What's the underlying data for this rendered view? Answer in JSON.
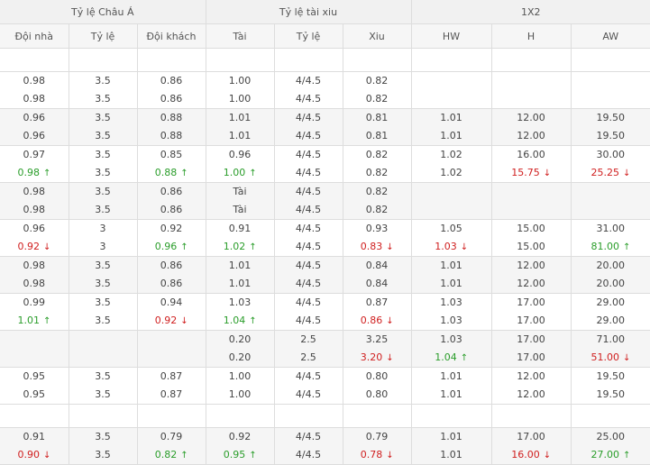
{
  "groups": [
    "Tỷ lệ Châu Á",
    "Tỷ lệ tài xiu",
    "1X2"
  ],
  "columns": [
    "Đội nhà",
    "Tỷ lệ",
    "Đội khách",
    "Tài",
    "Tỷ lệ",
    "Xiu",
    "HW",
    "H",
    "AW"
  ],
  "rows": [
    null,
    [
      [
        [
          "0.98",
          ""
        ],
        [
          "0.98",
          ""
        ]
      ],
      [
        [
          "3.5",
          ""
        ],
        [
          "3.5",
          ""
        ]
      ],
      [
        [
          "0.86",
          ""
        ],
        [
          "0.86",
          ""
        ]
      ],
      [
        [
          "1.00",
          ""
        ],
        [
          "1.00",
          ""
        ]
      ],
      [
        [
          "4/4.5",
          ""
        ],
        [
          "4/4.5",
          ""
        ]
      ],
      [
        [
          "0.82",
          ""
        ],
        [
          "0.82",
          ""
        ]
      ],
      [
        [
          "",
          ""
        ],
        [
          "",
          ""
        ]
      ],
      [
        [
          "",
          ""
        ],
        [
          "",
          ""
        ]
      ],
      [
        [
          "",
          ""
        ],
        [
          "",
          ""
        ]
      ]
    ],
    [
      [
        [
          "0.96",
          ""
        ],
        [
          "0.96",
          ""
        ]
      ],
      [
        [
          "3.5",
          ""
        ],
        [
          "3.5",
          ""
        ]
      ],
      [
        [
          "0.88",
          ""
        ],
        [
          "0.88",
          ""
        ]
      ],
      [
        [
          "1.01",
          ""
        ],
        [
          "1.01",
          ""
        ]
      ],
      [
        [
          "4/4.5",
          ""
        ],
        [
          "4/4.5",
          ""
        ]
      ],
      [
        [
          "0.81",
          ""
        ],
        [
          "0.81",
          ""
        ]
      ],
      [
        [
          "1.01",
          ""
        ],
        [
          "1.01",
          ""
        ]
      ],
      [
        [
          "12.00",
          ""
        ],
        [
          "12.00",
          ""
        ]
      ],
      [
        [
          "19.50",
          ""
        ],
        [
          "19.50",
          ""
        ]
      ]
    ],
    [
      [
        [
          "0.97",
          ""
        ],
        [
          "0.98",
          "up"
        ]
      ],
      [
        [
          "3.5",
          ""
        ],
        [
          "3.5",
          ""
        ]
      ],
      [
        [
          "0.85",
          ""
        ],
        [
          "0.88",
          "up"
        ]
      ],
      [
        [
          "0.96",
          ""
        ],
        [
          "1.00",
          "up"
        ]
      ],
      [
        [
          "4/4.5",
          ""
        ],
        [
          "4/4.5",
          ""
        ]
      ],
      [
        [
          "0.82",
          ""
        ],
        [
          "0.82",
          ""
        ]
      ],
      [
        [
          "1.02",
          ""
        ],
        [
          "1.02",
          ""
        ]
      ],
      [
        [
          "16.00",
          ""
        ],
        [
          "15.75",
          "down"
        ]
      ],
      [
        [
          "30.00",
          ""
        ],
        [
          "25.25",
          "down"
        ]
      ]
    ],
    [
      [
        [
          "0.98",
          ""
        ],
        [
          "0.98",
          ""
        ]
      ],
      [
        [
          "3.5",
          ""
        ],
        [
          "3.5",
          ""
        ]
      ],
      [
        [
          "0.86",
          ""
        ],
        [
          "0.86",
          ""
        ]
      ],
      [
        [
          "Tài",
          ""
        ],
        [
          "Tài",
          ""
        ]
      ],
      [
        [
          "4/4.5",
          ""
        ],
        [
          "4/4.5",
          ""
        ]
      ],
      [
        [
          "0.82",
          ""
        ],
        [
          "0.82",
          ""
        ]
      ],
      [
        [
          "",
          ""
        ],
        [
          "",
          ""
        ]
      ],
      [
        [
          "",
          ""
        ],
        [
          "",
          ""
        ]
      ],
      [
        [
          "",
          ""
        ],
        [
          "",
          ""
        ]
      ]
    ],
    [
      [
        [
          "0.96",
          ""
        ],
        [
          "0.92",
          "down"
        ]
      ],
      [
        [
          "3",
          ""
        ],
        [
          "3",
          ""
        ]
      ],
      [
        [
          "0.92",
          ""
        ],
        [
          "0.96",
          "up"
        ]
      ],
      [
        [
          "0.91",
          ""
        ],
        [
          "1.02",
          "up"
        ]
      ],
      [
        [
          "4/4.5",
          ""
        ],
        [
          "4/4.5",
          ""
        ]
      ],
      [
        [
          "0.93",
          ""
        ],
        [
          "0.83",
          "down"
        ]
      ],
      [
        [
          "1.05",
          ""
        ],
        [
          "1.03",
          "down"
        ]
      ],
      [
        [
          "15.00",
          ""
        ],
        [
          "15.00",
          ""
        ]
      ],
      [
        [
          "31.00",
          ""
        ],
        [
          "81.00",
          "up"
        ]
      ]
    ],
    [
      [
        [
          "0.98",
          ""
        ],
        [
          "0.98",
          ""
        ]
      ],
      [
        [
          "3.5",
          ""
        ],
        [
          "3.5",
          ""
        ]
      ],
      [
        [
          "0.86",
          ""
        ],
        [
          "0.86",
          ""
        ]
      ],
      [
        [
          "1.01",
          ""
        ],
        [
          "1.01",
          ""
        ]
      ],
      [
        [
          "4/4.5",
          ""
        ],
        [
          "4/4.5",
          ""
        ]
      ],
      [
        [
          "0.84",
          ""
        ],
        [
          "0.84",
          ""
        ]
      ],
      [
        [
          "1.01",
          ""
        ],
        [
          "1.01",
          ""
        ]
      ],
      [
        [
          "12.00",
          ""
        ],
        [
          "12.00",
          ""
        ]
      ],
      [
        [
          "20.00",
          ""
        ],
        [
          "20.00",
          ""
        ]
      ]
    ],
    [
      [
        [
          "0.99",
          ""
        ],
        [
          "1.01",
          "up"
        ]
      ],
      [
        [
          "3.5",
          ""
        ],
        [
          "3.5",
          ""
        ]
      ],
      [
        [
          "0.94",
          ""
        ],
        [
          "0.92",
          "down"
        ]
      ],
      [
        [
          "1.03",
          ""
        ],
        [
          "1.04",
          "up"
        ]
      ],
      [
        [
          "4/4.5",
          ""
        ],
        [
          "4/4.5",
          ""
        ]
      ],
      [
        [
          "0.87",
          ""
        ],
        [
          "0.86",
          "down"
        ]
      ],
      [
        [
          "1.03",
          ""
        ],
        [
          "1.03",
          ""
        ]
      ],
      [
        [
          "17.00",
          ""
        ],
        [
          "17.00",
          ""
        ]
      ],
      [
        [
          "29.00",
          ""
        ],
        [
          "29.00",
          ""
        ]
      ]
    ],
    [
      [
        [
          "",
          ""
        ],
        [
          "",
          ""
        ]
      ],
      [
        [
          "",
          ""
        ],
        [
          "",
          ""
        ]
      ],
      [
        [
          "",
          ""
        ],
        [
          "",
          ""
        ]
      ],
      [
        [
          "0.20",
          ""
        ],
        [
          "0.20",
          ""
        ]
      ],
      [
        [
          "2.5",
          ""
        ],
        [
          "2.5",
          ""
        ]
      ],
      [
        [
          "3.25",
          ""
        ],
        [
          "3.20",
          "down"
        ]
      ],
      [
        [
          "1.03",
          ""
        ],
        [
          "1.04",
          "up"
        ]
      ],
      [
        [
          "17.00",
          ""
        ],
        [
          "17.00",
          ""
        ]
      ],
      [
        [
          "71.00",
          ""
        ],
        [
          "51.00",
          "down"
        ]
      ]
    ],
    [
      [
        [
          "0.95",
          ""
        ],
        [
          "0.95",
          ""
        ]
      ],
      [
        [
          "3.5",
          ""
        ],
        [
          "3.5",
          ""
        ]
      ],
      [
        [
          "0.87",
          ""
        ],
        [
          "0.87",
          ""
        ]
      ],
      [
        [
          "1.00",
          ""
        ],
        [
          "1.00",
          ""
        ]
      ],
      [
        [
          "4/4.5",
          ""
        ],
        [
          "4/4.5",
          ""
        ]
      ],
      [
        [
          "0.80",
          ""
        ],
        [
          "0.80",
          ""
        ]
      ],
      [
        [
          "1.01",
          ""
        ],
        [
          "1.01",
          ""
        ]
      ],
      [
        [
          "12.00",
          ""
        ],
        [
          "12.00",
          ""
        ]
      ],
      [
        [
          "19.50",
          ""
        ],
        [
          "19.50",
          ""
        ]
      ]
    ],
    null,
    [
      [
        [
          "0.91",
          ""
        ],
        [
          "0.90",
          "down"
        ]
      ],
      [
        [
          "3.5",
          ""
        ],
        [
          "3.5",
          ""
        ]
      ],
      [
        [
          "0.79",
          ""
        ],
        [
          "0.82",
          "up"
        ]
      ],
      [
        [
          "0.92",
          ""
        ],
        [
          "0.95",
          "up"
        ]
      ],
      [
        [
          "4/4.5",
          ""
        ],
        [
          "4/4.5",
          ""
        ]
      ],
      [
        [
          "0.79",
          ""
        ],
        [
          "0.78",
          "down"
        ]
      ],
      [
        [
          "1.01",
          ""
        ],
        [
          "1.01",
          ""
        ]
      ],
      [
        [
          "17.00",
          ""
        ],
        [
          "16.00",
          "down"
        ]
      ],
      [
        [
          "25.00",
          ""
        ],
        [
          "27.00",
          "up"
        ]
      ]
    ]
  ],
  "icons": {
    "up": "arrow-up-icon",
    "down": "arrow-down-icon"
  },
  "colors": {
    "up": "#2a9d2a",
    "down": "#d02020",
    "header_bg": "#f1f1f1",
    "row_alt_bg": "#f5f5f5",
    "border": "#dddddd"
  }
}
